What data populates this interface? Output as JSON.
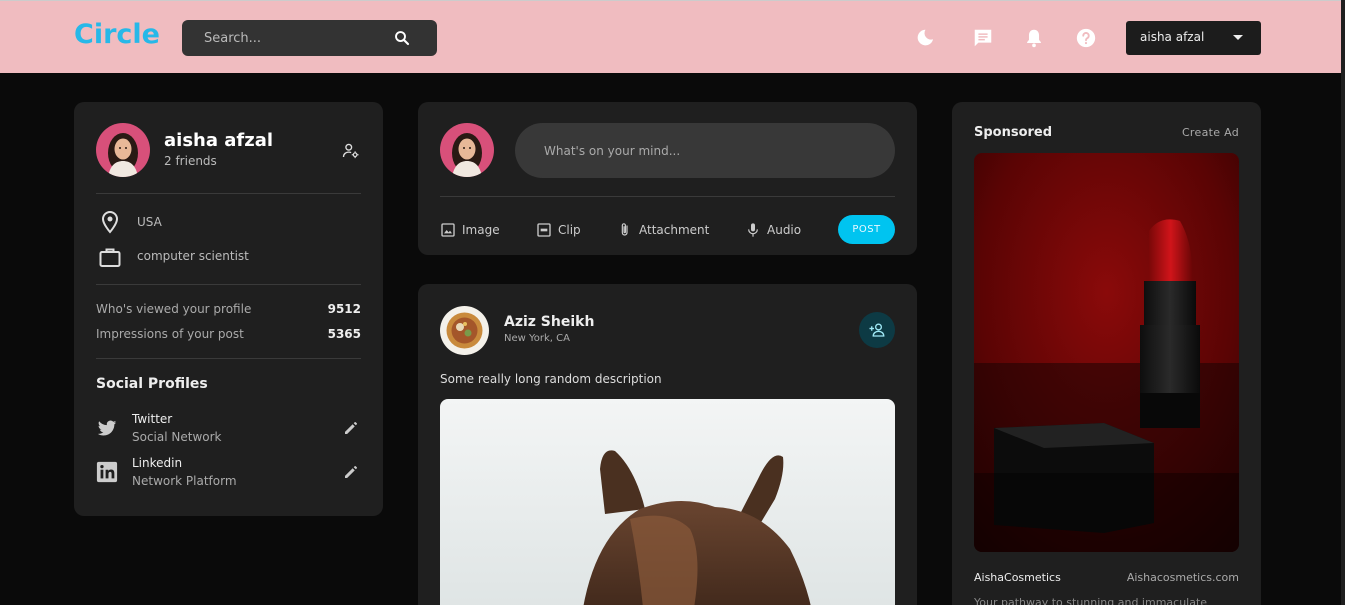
{
  "navbar": {
    "logo": "Circle",
    "search_placeholder": "Search...",
    "user_menu_label": "aisha afzal",
    "colors": {
      "background": "#f0bcc0",
      "logo": "#27b8e8"
    }
  },
  "profile": {
    "name": "aisha afzal",
    "friends": "2 friends",
    "location": "USA",
    "occupation": "computer scientist",
    "stats": [
      {
        "label": "Who's viewed your profile",
        "value": "9512"
      },
      {
        "label": "Impressions of your post",
        "value": "5365"
      }
    ],
    "social_title": "Social Profiles",
    "socials": [
      {
        "name": "Twitter",
        "sub": "Social Network",
        "icon": "twitter-icon"
      },
      {
        "name": "Linkedin",
        "sub": "Network Platform",
        "icon": "linkedin-icon"
      }
    ]
  },
  "create_post": {
    "placeholder": "What's on your mind...",
    "actions": [
      {
        "label": "Image",
        "icon": "image-icon"
      },
      {
        "label": "Clip",
        "icon": "gif-icon"
      },
      {
        "label": "Attachment",
        "icon": "paperclip-icon"
      },
      {
        "label": "Audio",
        "icon": "microphone-icon"
      }
    ],
    "post_label": "POST",
    "accent": "#00c4f0"
  },
  "feed_post": {
    "author": "Aziz Sheikh",
    "location": "New York, CA",
    "description": "Some really long random description"
  },
  "sponsored": {
    "title": "Sponsored",
    "create_ad": "Create Ad",
    "brand": "AishaCosmetics",
    "url": "Aishacosmetics.com",
    "description": "Your pathway to stunning and immaculate"
  }
}
